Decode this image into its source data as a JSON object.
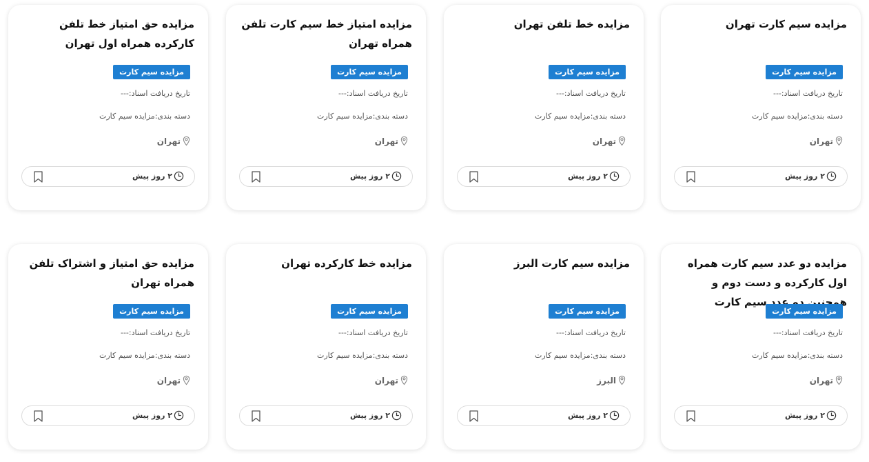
{
  "listings": [
    {
      "title": "مزایده سیم کارت تهران",
      "badge": "مزایده سیم کارت",
      "date_line": "تاریخ دریافت اسناد:---",
      "category_line": "دسته بندی:مزایده سیم کارت",
      "location": "تهران",
      "time_ago": "۲ روز پیش"
    },
    {
      "title": "مزایده خط تلفن تهران",
      "badge": "مزایده سیم کارت",
      "date_line": "تاریخ دریافت اسناد:---",
      "category_line": "دسته بندی:مزایده سیم کارت",
      "location": "تهران",
      "time_ago": "۲ روز پیش"
    },
    {
      "title": "مزایده امتیاز خط سیم کارت تلفن همراه تهران",
      "badge": "مزایده سیم کارت",
      "date_line": "تاریخ دریافت اسناد:---",
      "category_line": "دسته بندی:مزایده سیم کارت",
      "location": "تهران",
      "time_ago": "۲ روز پیش"
    },
    {
      "title": "مزایده حق امتیاز خط تلفن کارکرده همراه اول تهران",
      "badge": "مزایده سیم کارت",
      "date_line": "تاریخ دریافت اسناد:---",
      "category_line": "دسته بندی:مزایده سیم کارت",
      "location": "تهران",
      "time_ago": "۲ روز پیش"
    },
    {
      "title": "مزایده دو عدد سیم کارت همراه اول کارکرده و دست دوم و همچنین دو عدد سیم کارت",
      "badge": "مزایده سیم کارت",
      "date_line": "تاریخ دریافت اسناد:---",
      "category_line": "دسته بندی:مزایده سیم کارت",
      "location": "تهران",
      "time_ago": "۲ روز پیش"
    },
    {
      "title": "مزایده سیم کارت البرز",
      "badge": "مزایده سیم کارت",
      "date_line": "تاریخ دریافت اسناد:---",
      "category_line": "دسته بندی:مزایده سیم کارت",
      "location": "البرز",
      "time_ago": "۲ روز پیش"
    },
    {
      "title": "مزایده خط کارکرده تهران",
      "badge": "مزایده سیم کارت",
      "date_line": "تاریخ دریافت اسناد:---",
      "category_line": "دسته بندی:مزایده سیم کارت",
      "location": "تهران",
      "time_ago": "۲ روز پیش"
    },
    {
      "title": "مزایده حق امتیاز و اشتراک تلفن همراه تهران",
      "badge": "مزایده سیم کارت",
      "date_line": "تاریخ دریافت اسناد:---",
      "category_line": "دسته بندی:مزایده سیم کارت",
      "location": "تهران",
      "time_ago": "۲ روز پیش"
    }
  ],
  "icons": {
    "location": "map-pin-icon",
    "time": "clock-icon",
    "bookmark": "bookmark-icon"
  },
  "colors": {
    "badge_bg": "#1e7fd2",
    "badge_text": "#ffffff",
    "title_text": "#111111",
    "meta_text": "#555555"
  }
}
